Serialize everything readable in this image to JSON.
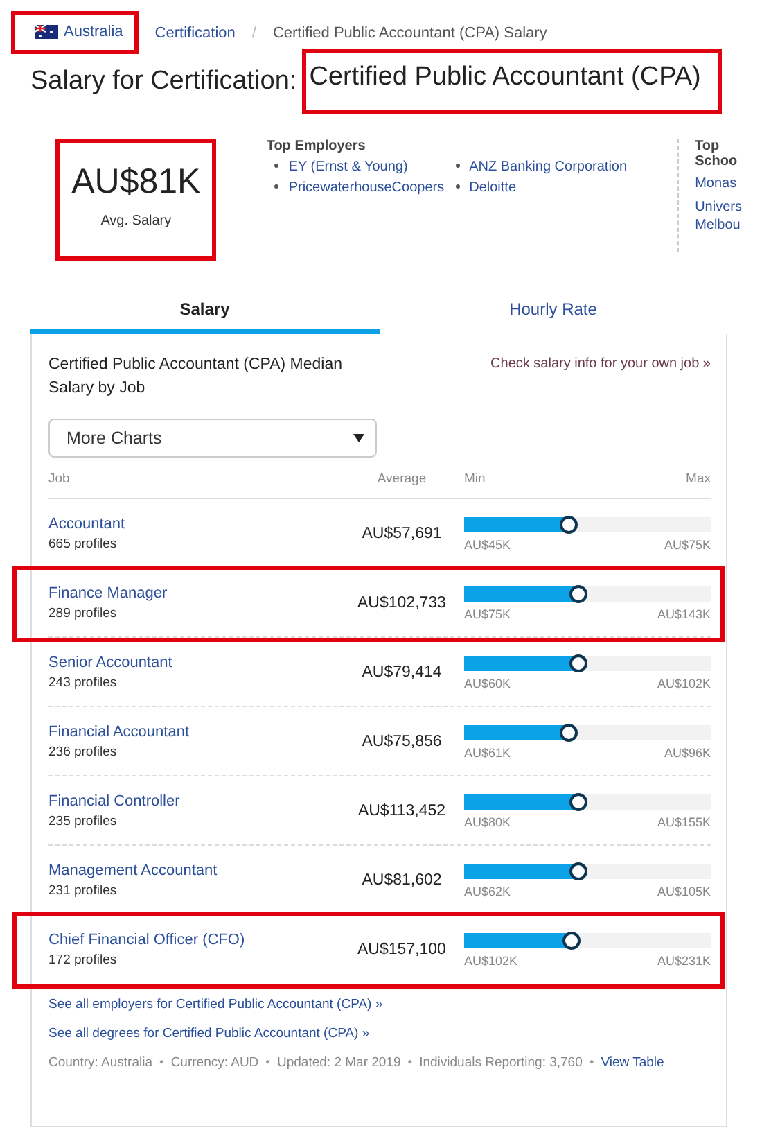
{
  "breadcrumb": [
    {
      "label": "Australia",
      "kind": "flag",
      "highlighted": true
    },
    {
      "label": "Certification",
      "kind": "link",
      "highlighted": false
    },
    {
      "label": "/",
      "kind": "separator",
      "highlighted": false
    },
    {
      "label": "Certified Public Accountant (CPA) Salary",
      "kind": "current",
      "highlighted": false
    }
  ],
  "heading": {
    "prefix": "Salary for Certification:",
    "name": "Certified Public Accountant (CPA)",
    "highlighted": true
  },
  "summary": {
    "value": "AU$81K",
    "label": "Avg. Salary",
    "highlighted": true
  },
  "top_employers": {
    "title": "Top Employers",
    "items": [
      "EY (Ernst & Young)",
      "PricewaterhouseCoopers",
      "ANZ Banking Corporation",
      "Deloitte"
    ]
  },
  "top_schools": {
    "title": "Top Schoo",
    "items": [
      "Monas",
      "Univers Melbou"
    ]
  },
  "tabs": [
    {
      "label": "Salary",
      "selected": true
    },
    {
      "label": "Hourly Rate",
      "selected": false
    }
  ],
  "card": {
    "title": "Certified Public Accountant (CPA) Median Salary by Job",
    "check_link": "Check salary info for your own job »",
    "dropdown": "More Charts",
    "columns": [
      "Job",
      "Average",
      "Min",
      "Max"
    ],
    "rows": [
      {
        "job": "Accountant",
        "profiles": "665 profiles",
        "average": "AU$57,691",
        "level": 0.42,
        "min": "AU$45K",
        "max": "AU$75K",
        "highlighted": false
      },
      {
        "job": "Finance Manager",
        "profiles": "289 profiles",
        "average": "AU$102,733",
        "level": 0.46,
        "min": "AU$75K",
        "max": "AU$143K",
        "highlighted": true
      },
      {
        "job": "Senior Accountant",
        "profiles": "243 profiles",
        "average": "AU$79,414",
        "level": 0.46,
        "min": "AU$60K",
        "max": "AU$102K",
        "highlighted": false
      },
      {
        "job": "Financial Accountant",
        "profiles": "236 profiles",
        "average": "AU$75,856",
        "level": 0.42,
        "min": "AU$61K",
        "max": "AU$96K",
        "highlighted": false
      },
      {
        "job": "Financial Controller",
        "profiles": "235 profiles",
        "average": "AU$113,452",
        "level": 0.46,
        "min": "AU$80K",
        "max": "AU$155K",
        "highlighted": false
      },
      {
        "job": "Management Accountant",
        "profiles": "231 profiles",
        "average": "AU$81,602",
        "level": 0.46,
        "min": "AU$62K",
        "max": "AU$105K",
        "highlighted": false
      },
      {
        "job": "Chief Financial Officer (CFO)",
        "profiles": "172 profiles",
        "average": "AU$157,100",
        "level": 0.43,
        "min": "AU$102K",
        "max": "AU$231K",
        "highlighted": true
      }
    ],
    "links": [
      "See all employers for Certified Public Accountant (CPA) »",
      "See all degrees for Certified Public Accountant (CPA) »"
    ],
    "meta": [
      {
        "kind": "text",
        "label": "Country: Australia"
      },
      {
        "kind": "separator",
        "label": "•"
      },
      {
        "kind": "text",
        "label": "Currency: AUD"
      },
      {
        "kind": "separator",
        "label": "•"
      },
      {
        "kind": "text",
        "label": "Updated: 2 Mar 2019"
      },
      {
        "kind": "separator",
        "label": "•"
      },
      {
        "kind": "text",
        "label": "Individuals Reporting: 3,760"
      },
      {
        "kind": "separator",
        "label": "•"
      }
    ],
    "view_table": "View Table"
  }
}
